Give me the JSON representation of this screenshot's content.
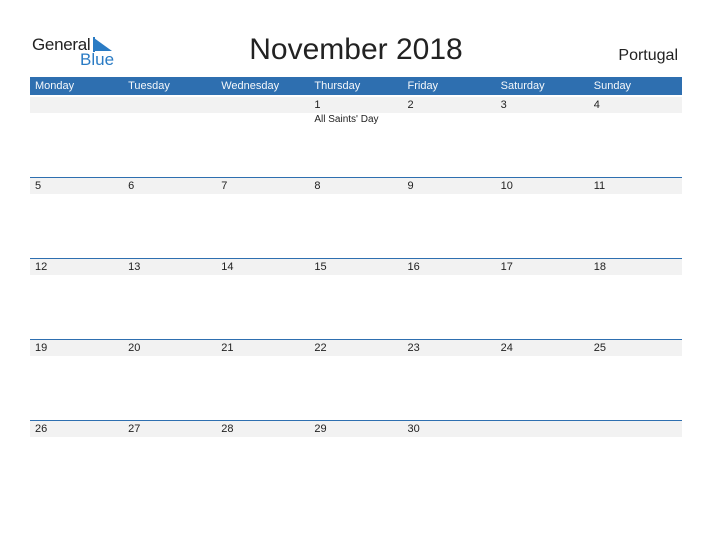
{
  "logo": {
    "general": "General",
    "blue": "Blue"
  },
  "title": "November 2018",
  "country": "Portugal",
  "colors": {
    "header": "#2e6fb0",
    "accent": "#2a7bc4",
    "strip": "#f2f2f2"
  },
  "weekdays": [
    "Monday",
    "Tuesday",
    "Wednesday",
    "Thursday",
    "Friday",
    "Saturday",
    "Sunday"
  ],
  "weeks": [
    {
      "days": [
        "",
        "",
        "",
        "1",
        "2",
        "3",
        "4"
      ],
      "events": [
        "",
        "",
        "",
        "All Saints' Day",
        "",
        "",
        ""
      ]
    },
    {
      "days": [
        "5",
        "6",
        "7",
        "8",
        "9",
        "10",
        "11"
      ],
      "events": [
        "",
        "",
        "",
        "",
        "",
        "",
        ""
      ]
    },
    {
      "days": [
        "12",
        "13",
        "14",
        "15",
        "16",
        "17",
        "18"
      ],
      "events": [
        "",
        "",
        "",
        "",
        "",
        "",
        ""
      ]
    },
    {
      "days": [
        "19",
        "20",
        "21",
        "22",
        "23",
        "24",
        "25"
      ],
      "events": [
        "",
        "",
        "",
        "",
        "",
        "",
        ""
      ]
    },
    {
      "days": [
        "26",
        "27",
        "28",
        "29",
        "30",
        "",
        ""
      ],
      "events": [
        "",
        "",
        "",
        "",
        "",
        "",
        ""
      ]
    }
  ]
}
